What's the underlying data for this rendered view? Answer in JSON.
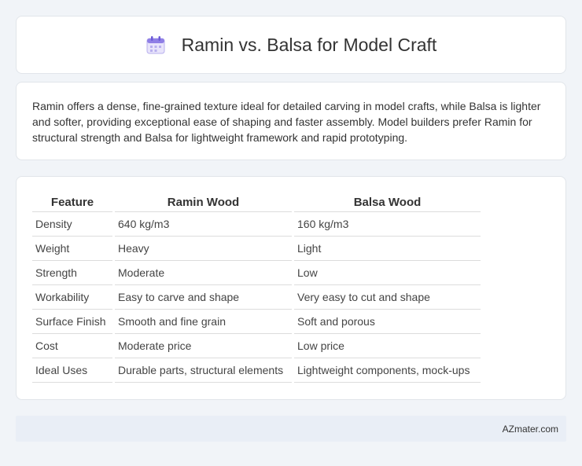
{
  "header": {
    "title": "Ramin vs. Balsa for Model Craft",
    "icon": "calendar-icon"
  },
  "description": {
    "text": "Ramin offers a dense, fine-grained texture ideal for detailed carving in model crafts, while Balsa is lighter and softer, providing exceptional ease of shaping and faster assembly. Model builders prefer Ramin for structural strength and Balsa for lightweight framework and rapid prototyping."
  },
  "table": {
    "headers": [
      "Feature",
      "Ramin Wood",
      "Balsa Wood"
    ],
    "rows": [
      [
        "Density",
        "640 kg/m3",
        "160 kg/m3"
      ],
      [
        "Weight",
        "Heavy",
        "Light"
      ],
      [
        "Strength",
        "Moderate",
        "Low"
      ],
      [
        "Workability",
        "Easy to carve and shape",
        "Very easy to cut and shape"
      ],
      [
        "Surface Finish",
        "Smooth and fine grain",
        "Soft and porous"
      ],
      [
        "Cost",
        "Moderate price",
        "Low price"
      ],
      [
        "Ideal Uses",
        "Durable parts, structural elements",
        "Lightweight components, mock-ups"
      ]
    ]
  },
  "footer": {
    "text": "AZmater.com"
  }
}
